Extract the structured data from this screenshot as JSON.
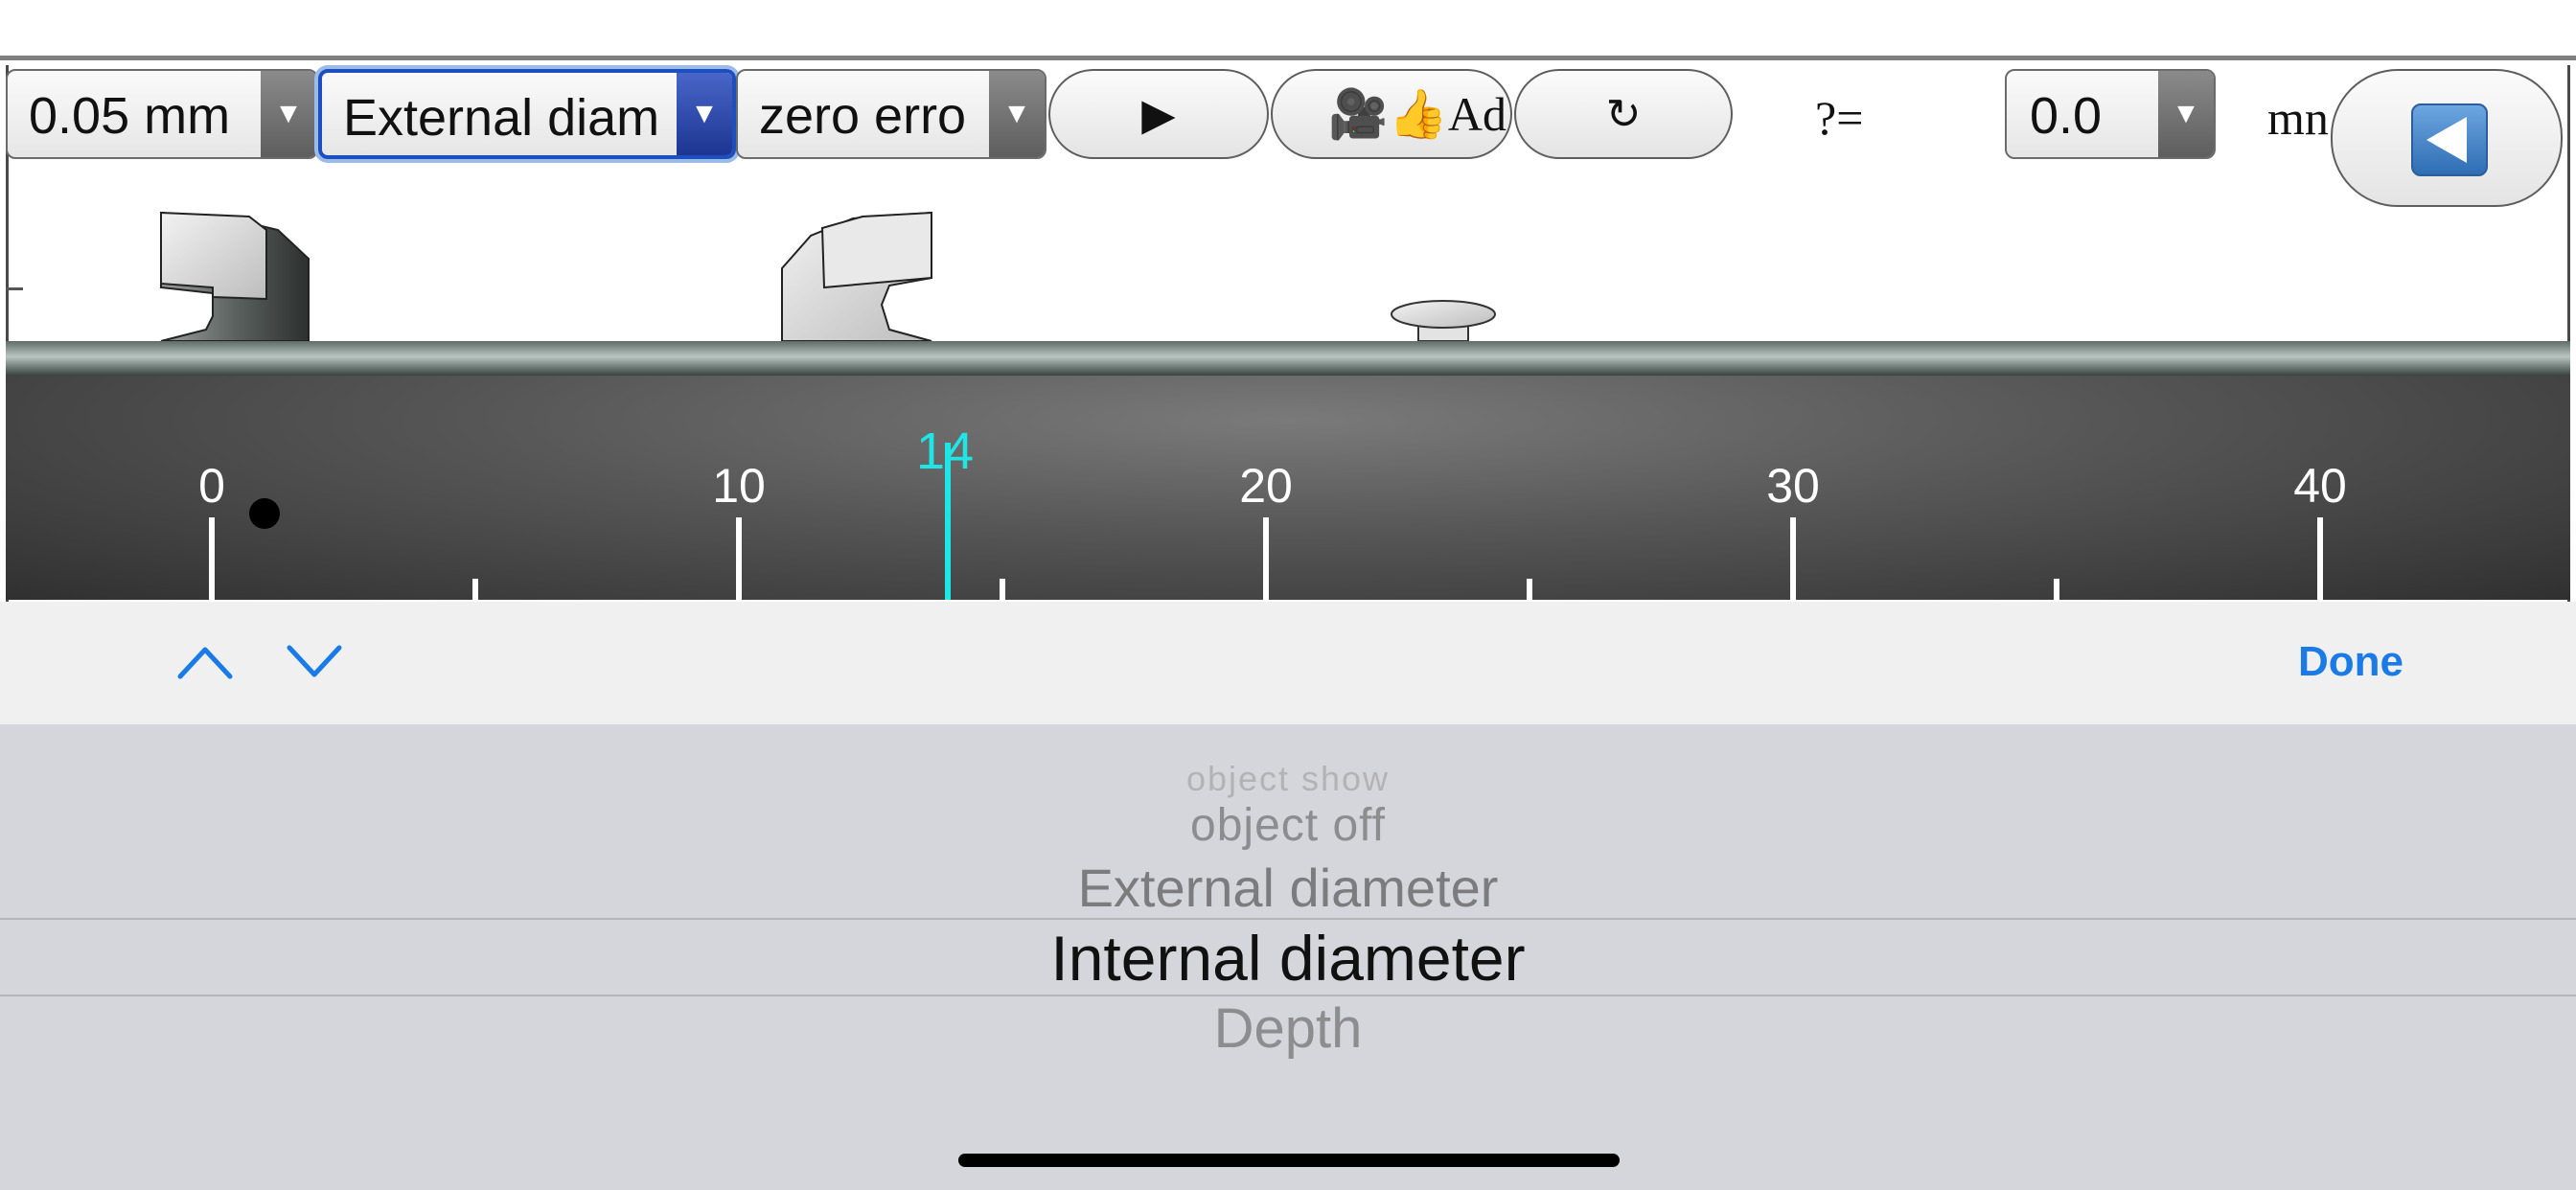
{
  "toolbar": {
    "precision_value": "0.05 mm",
    "mode_value": "External diam",
    "zero_value": "zero erro",
    "play_label": "▶",
    "ad_label": "🎥👍Ad",
    "reset_label": "↻",
    "question_label": "?=",
    "answer_value": "0.0",
    "unit_label": "mn",
    "dropdown_arrow": "▼"
  },
  "scale": {
    "major_labels": [
      "0",
      "10",
      "20",
      "30",
      "40"
    ],
    "reading_label": "14"
  },
  "accessory": {
    "done_label": "Done"
  },
  "picker": {
    "options": [
      "object show",
      "object off",
      "External diameter",
      "Internal diameter",
      "Depth"
    ],
    "selected": "Internal diameter"
  },
  "colors": {
    "reading": "#1ee6e6",
    "accent": "#1a7ae6",
    "active_select": "#1e4fbf"
  }
}
